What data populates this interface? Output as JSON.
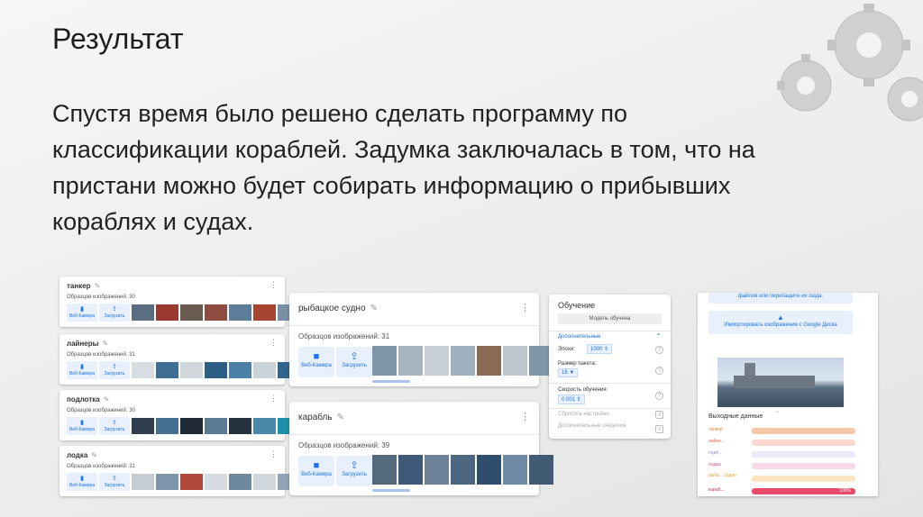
{
  "slide": {
    "title": "Результат",
    "body": "Спустя время было решено сделать программу по классификации кораблей. Задумка заключалась в том, что на пристани можно будет собирать информацию о прибывших кораблях и судах."
  },
  "left_classes": [
    {
      "name": "танкер",
      "samples": "Образцов изображений: 30"
    },
    {
      "name": "лайнеры",
      "samples": "Образцов изображений: 31"
    },
    {
      "name": "подлотка",
      "samples": "Образцов изображений: 30"
    },
    {
      "name": "лодка",
      "samples": "Образцов изображений: 31"
    }
  ],
  "mid_classes": [
    {
      "name": "рыбацкое судно",
      "samples": "Образцов изображений: 31"
    },
    {
      "name": "карабль",
      "samples": "Образцов изображений: 39"
    }
  ],
  "buttons": {
    "webcam": "Веб-Камера",
    "upload": "Загрузить",
    "webcam_icon": "video-camera-icon",
    "upload_icon": "upload-icon"
  },
  "training": {
    "title": "Обучение",
    "model_button": "Модель обучена",
    "advanced": "Дополнительные",
    "epochs_label": "Эпохи:",
    "epochs_value": "1000",
    "batch_label": "Размер пакета:",
    "batch_value": "16",
    "lr_label": "Скорость обучения:",
    "lr_value": "0.001",
    "reset": "Сбросить настройки",
    "more": "Дополнительные сведения"
  },
  "preview": {
    "top_button": "файлов или перетащите их сюда.",
    "import_button": "Импортировать изображения с Google Диска",
    "output_title": "Выходные данные",
    "outputs": [
      {
        "label": "танкер",
        "color": "#f5c9a8",
        "percent": 0
      },
      {
        "label": "лайне...",
        "color": "#f9d8cf",
        "percent": 0
      },
      {
        "label": "подл...",
        "color": "#e9ecf8",
        "percent": 0
      },
      {
        "label": "лодка",
        "color": "#f8d9ea",
        "percent": 0
      },
      {
        "label": "рыба... судно",
        "color": "#fde6c4",
        "percent": 0
      },
      {
        "label": "караб...",
        "color": "#e94b6b",
        "percent": 100,
        "percent_text": "100%"
      }
    ]
  },
  "colors": {
    "accent": "#1a73e8",
    "accent_light": "#e8f0fe"
  }
}
